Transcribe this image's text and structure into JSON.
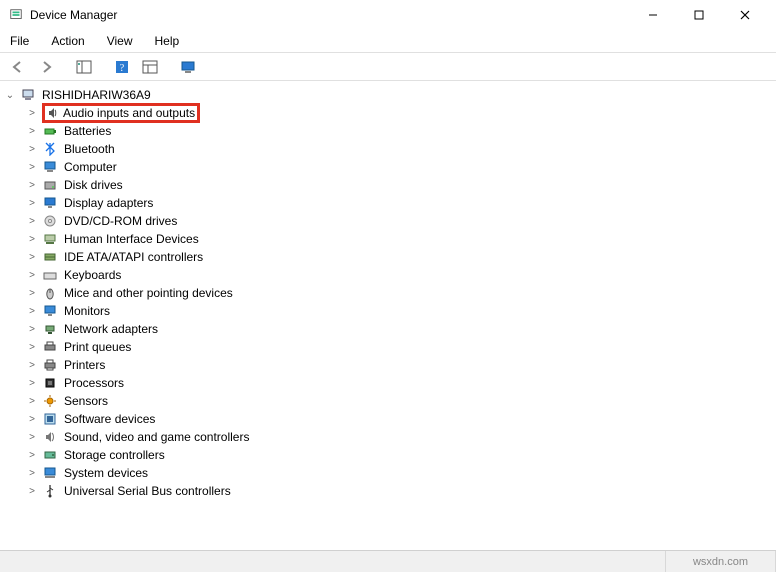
{
  "window": {
    "title": "Device Manager"
  },
  "menu": {
    "file": "File",
    "action": "Action",
    "view": "View",
    "help": "Help"
  },
  "tree": {
    "root": "RISHIDHARIW36A9",
    "items": [
      "Audio inputs and outputs",
      "Batteries",
      "Bluetooth",
      "Computer",
      "Disk drives",
      "Display adapters",
      "DVD/CD-ROM drives",
      "Human Interface Devices",
      "IDE ATA/ATAPI controllers",
      "Keyboards",
      "Mice and other pointing devices",
      "Monitors",
      "Network adapters",
      "Print queues",
      "Printers",
      "Processors",
      "Sensors",
      "Software devices",
      "Sound, video and game controllers",
      "Storage controllers",
      "System devices",
      "Universal Serial Bus controllers"
    ]
  },
  "watermark": "wsxdn.com"
}
